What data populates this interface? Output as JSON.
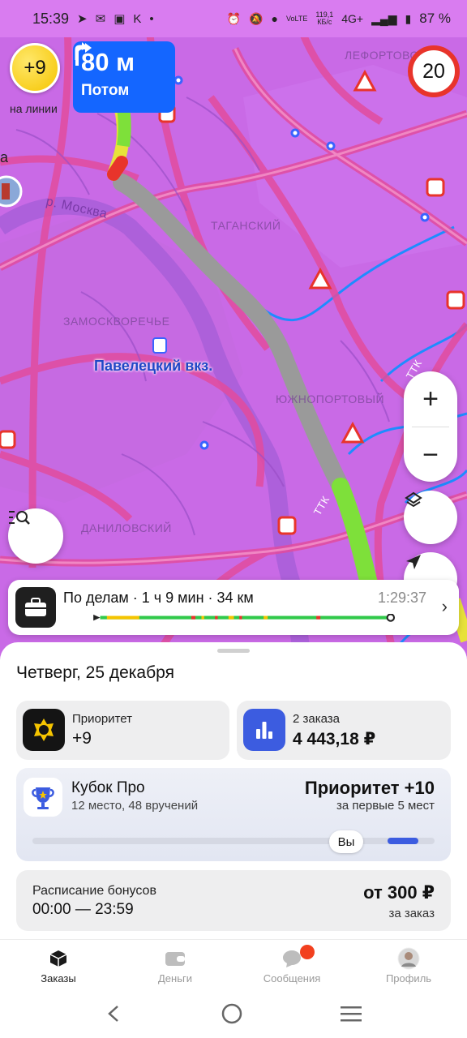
{
  "status_bar": {
    "time": "15:39",
    "data_speed": "119,1",
    "data_speed_unit": "КБ/с",
    "volte": "VoLTE",
    "network": "4G+",
    "battery": "87 %"
  },
  "map": {
    "priority_badge": "+9",
    "online_label": "на линии",
    "maneuver": {
      "distance": "80 м",
      "next_label": "Потом"
    },
    "speed_limit": "20",
    "labels": {
      "lefortovo": "ЛЕФОРТОВО",
      "taganskiy": "ТАГАНСКИЙ",
      "zamoskvorechye": "ЗАМОСКВОРЕЧЬЕ",
      "paveletskiy": "Павелецкий вкз.",
      "yuzhnoportovy": "ЮЖНОПОРТОВЫЙ",
      "danilovskiy": "ДАНИЛОВСКИЙ",
      "river": "р. Москва",
      "ttk1": "ТТК",
      "ttk2": "ТТК",
      "partial_a": "а"
    },
    "zoom_in": "+",
    "zoom_out": "−"
  },
  "route_bar": {
    "title": "По делам · 1 ч 9 мин · 34 км",
    "eta": "1:29:37"
  },
  "sheet": {
    "date": "Четверг, 25 декабря",
    "priority": {
      "label": "Приоритет",
      "value": "+9"
    },
    "orders": {
      "label": "2 заказа",
      "value": "4 443,18 ₽"
    },
    "cup": {
      "title": "Кубок Про",
      "subtitle": "12 место, 48 вручений",
      "prize": "Приоритет +10",
      "prize_sub": "за первые 5 мест",
      "you_label": "Вы"
    },
    "bonus": {
      "label": "Расписание бонусов",
      "time": "00:00 — 23:59",
      "amount": "от 300 ₽",
      "amount_sub": "за заказ"
    }
  },
  "tabs": [
    {
      "label": "Заказы",
      "icon": "box-icon",
      "active": true
    },
    {
      "label": "Деньги",
      "icon": "wallet-icon",
      "active": false
    },
    {
      "label": "Сообщения",
      "icon": "chat-icon",
      "active": false
    },
    {
      "label": "Профиль",
      "icon": "avatar-icon",
      "active": false
    }
  ],
  "colors": {
    "map_bg": "#c96ae6",
    "maneuver_bg": "#1466ff",
    "speed_limit_ring": "#e8342b",
    "route_gray": "#9a9a9a",
    "route_green": "#7ee03a",
    "accent_blue": "#3c5ce0",
    "notification_red": "#f2401f"
  }
}
